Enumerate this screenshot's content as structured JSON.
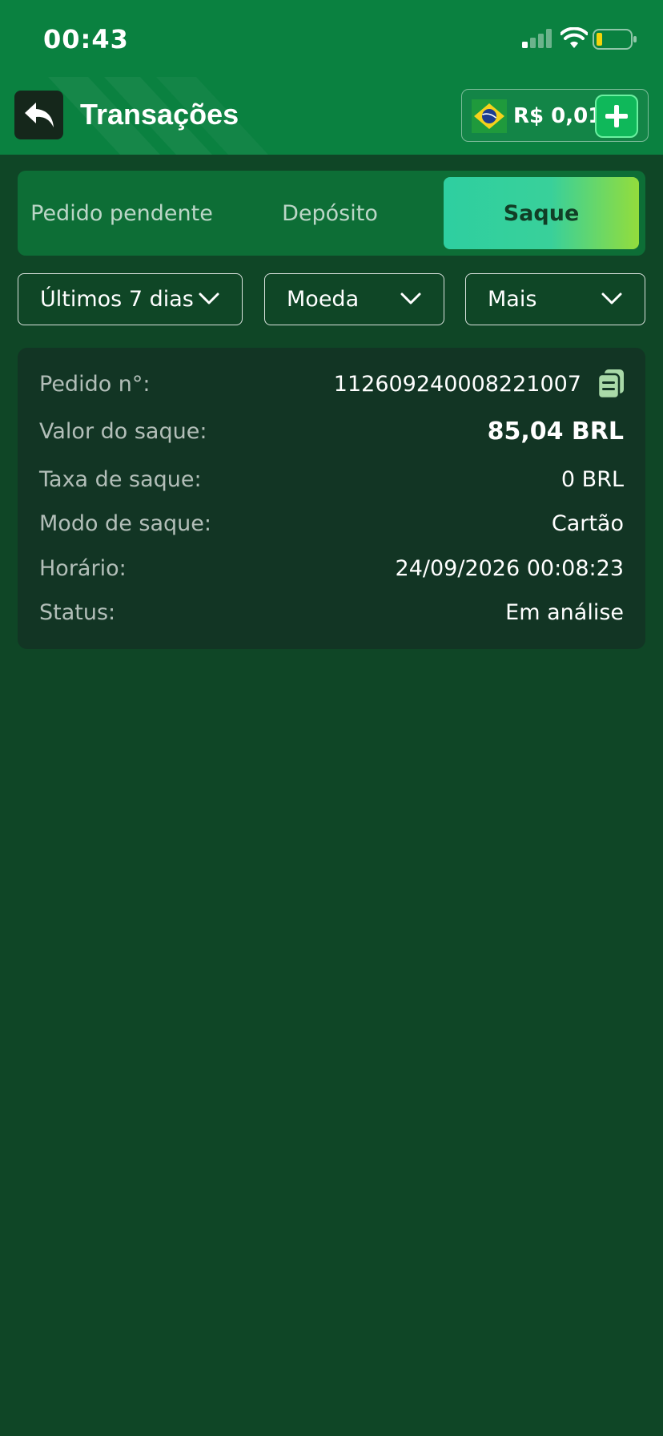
{
  "status_bar": {
    "time": "00:43"
  },
  "header": {
    "title": "Transações",
    "balance": "R$ 0,01",
    "back_icon": "reply-arrow-icon",
    "flag_icon": "brazil-flag-icon",
    "add_icon": "plus-icon"
  },
  "tabs": [
    {
      "label": "Pedido pendente",
      "active": false
    },
    {
      "label": "Depósito",
      "active": false
    },
    {
      "label": "Saque",
      "active": true
    }
  ],
  "filters": {
    "days": "Últimos 7 dias",
    "currency": "Moeda",
    "more": "Mais"
  },
  "transaction": {
    "order_label": "Pedido n°:",
    "order_value": "112609240008221007",
    "amount_label": "Valor do saque:",
    "amount_value": "85,04 BRL",
    "fee_label": "Taxa de saque:",
    "fee_value": "0 BRL",
    "mode_label": "Modo de saque:",
    "mode_value": "Cartão",
    "time_label": "Horário:",
    "time_value": "24/09/2026 00:08:23",
    "status_label": "Status:",
    "status_value": "Em análise"
  },
  "colors": {
    "background": "#0f4626",
    "header": "#0a8140",
    "card": "#123524",
    "tab_bar": "#0d6e36",
    "active_tab_gradient_start": "#2ecfa0",
    "active_tab_gradient_end": "#93dd3c"
  }
}
